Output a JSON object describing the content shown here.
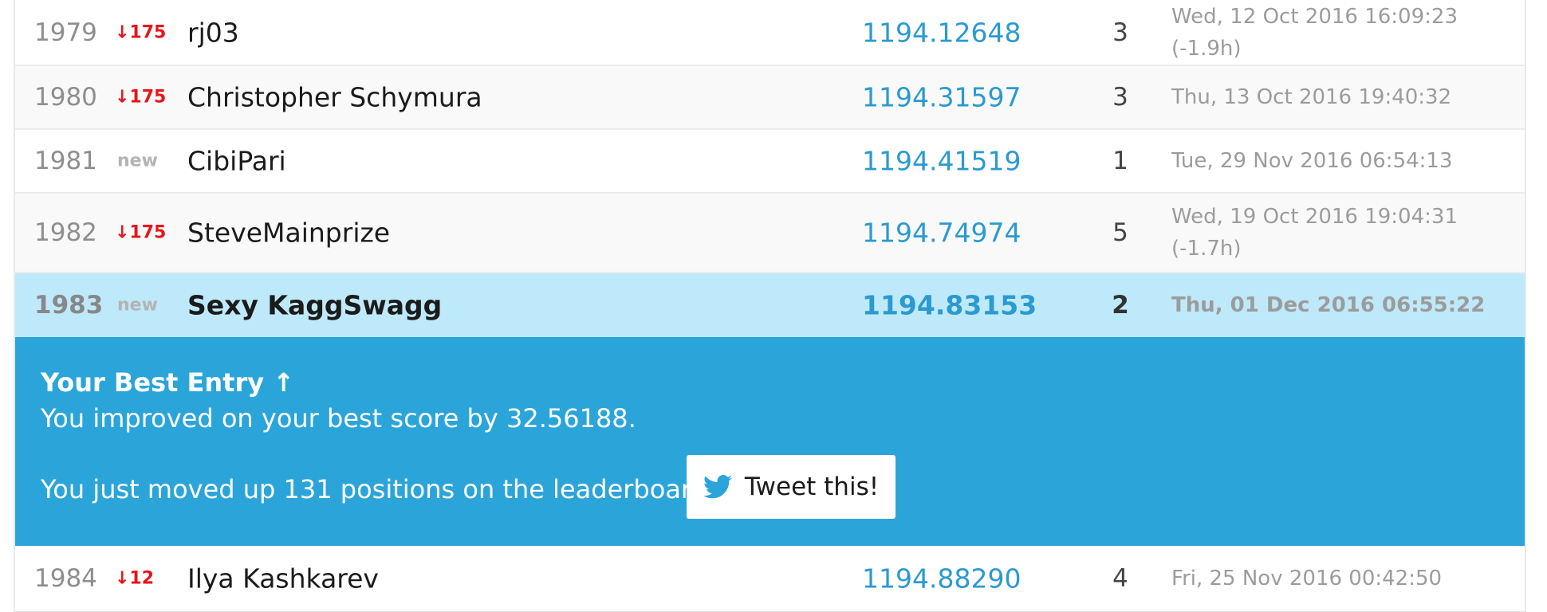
{
  "rows_top": [
    {
      "rank": "1979",
      "delta": "↓175",
      "delta_type": "down",
      "team": "rj03",
      "score": "1194.12648",
      "entries": "3",
      "last_sub": [
        "Wed, 12 Oct 2016 16:09:23",
        "(-1.9h)"
      ]
    },
    {
      "rank": "1980",
      "delta": "↓175",
      "delta_type": "down",
      "team": "Christopher Schymura",
      "score": "1194.31597",
      "entries": "3",
      "last_sub": [
        "Thu, 13 Oct 2016 19:40:32"
      ]
    },
    {
      "rank": "1981",
      "delta": "new",
      "delta_type": "new",
      "team": "CibiPari",
      "score": "1194.41519",
      "entries": "1",
      "last_sub": [
        "Tue, 29 Nov 2016 06:54:13"
      ]
    },
    {
      "rank": "1982",
      "delta": "↓175",
      "delta_type": "down",
      "team": "SteveMainprize",
      "score": "1194.74974",
      "entries": "5",
      "last_sub": [
        "Wed, 19 Oct 2016 19:04:31",
        "(-1.7h)"
      ]
    }
  ],
  "highlight_row": {
    "rank": "1983",
    "delta": "new",
    "team": "Sexy KaggSwagg",
    "score": "1194.83153",
    "entries": "2",
    "last_sub": "Thu, 01 Dec 2016 06:55:22"
  },
  "banner": {
    "title": "Your Best Entry ↑",
    "improved": "You improved on your best score by 32.56188.",
    "moved": "You just moved up 131 positions on the leaderboard.",
    "tweet_label": "Tweet this!",
    "tweet_icon": "twitter-bird-icon"
  },
  "row_bottom": {
    "rank": "1984",
    "delta": "↓12",
    "team": "Ilya Kashkarev",
    "score": "1194.88290",
    "entries": "4",
    "last_sub": "Fri, 25 Nov 2016 00:42:50"
  },
  "colors": {
    "accent": "#2ba5d9",
    "score": "#2b9ad0",
    "highlight": "#bee9fa",
    "down": "#e8141b",
    "new": "#b4b4b4"
  }
}
